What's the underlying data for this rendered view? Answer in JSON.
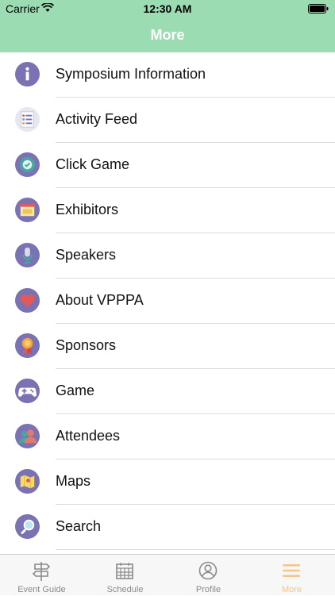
{
  "status_bar": {
    "carrier": "Carrier",
    "time": "12:30 AM"
  },
  "nav": {
    "title": "More"
  },
  "menu": [
    {
      "label": "Symposium Information",
      "icon": "info-icon"
    },
    {
      "label": "Activity Feed",
      "icon": "activity-feed-icon"
    },
    {
      "label": "Click Game",
      "icon": "click-game-icon"
    },
    {
      "label": "Exhibitors",
      "icon": "exhibitors-icon"
    },
    {
      "label": "Speakers",
      "icon": "microphone-icon"
    },
    {
      "label": "About VPPPA",
      "icon": "heart-icon"
    },
    {
      "label": "Sponsors",
      "icon": "award-ribbon-icon"
    },
    {
      "label": "Game",
      "icon": "gamepad-icon"
    },
    {
      "label": "Attendees",
      "icon": "attendees-icon"
    },
    {
      "label": "Maps",
      "icon": "map-icon"
    },
    {
      "label": "Search",
      "icon": "search-icon"
    }
  ],
  "tabs": [
    {
      "label": "Event Guide",
      "icon": "signpost-icon"
    },
    {
      "label": "Schedule",
      "icon": "calendar-icon"
    },
    {
      "label": "Profile",
      "icon": "profile-icon"
    },
    {
      "label": "More",
      "icon": "hamburger-icon",
      "active": true
    }
  ],
  "colors": {
    "header": "#9cdcb3",
    "icon_circle": "#7b72b4",
    "active_tab": "#f5c58c",
    "inactive_tab": "#8a8a8a"
  }
}
